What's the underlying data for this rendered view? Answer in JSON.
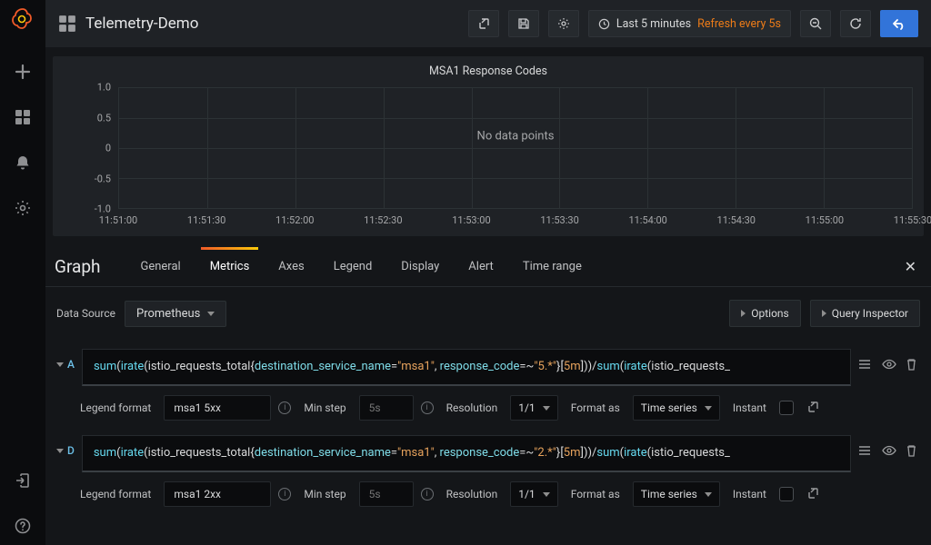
{
  "dashboard_title": "Telemetry-Demo",
  "time_range_label": "Last 5 minutes",
  "refresh_label": "Refresh every 5s",
  "chart_data": {
    "type": "line",
    "title": "MSA1 Response Codes",
    "y_ticks": [
      "-1.0",
      "-0.5",
      "0",
      "0.5",
      "1.0"
    ],
    "x_ticks": [
      "11:51:00",
      "11:51:30",
      "11:52:00",
      "11:52:30",
      "11:53:00",
      "11:53:30",
      "11:54:00",
      "11:54:30",
      "11:55:00",
      "11:55:30"
    ],
    "message": "No data points",
    "series": [],
    "ylim": [
      -1.0,
      1.0
    ]
  },
  "editor": {
    "title": "Graph",
    "tabs": [
      "General",
      "Metrics",
      "Axes",
      "Legend",
      "Display",
      "Alert",
      "Time range"
    ],
    "active_tab": "Metrics",
    "datasource_label": "Data Source",
    "datasource_value": "Prometheus",
    "options_btn": "Options",
    "inspector_btn": "Query Inspector"
  },
  "queries": [
    {
      "letter": "A",
      "tokens": [
        {
          "t": "fn",
          "v": "sum"
        },
        {
          "t": "p",
          "v": "("
        },
        {
          "t": "fn",
          "v": "irate"
        },
        {
          "t": "p",
          "v": "("
        },
        {
          "t": "m",
          "v": "istio_requests_total"
        },
        {
          "t": "p",
          "v": "{"
        },
        {
          "t": "l",
          "v": "destination_service_name"
        },
        {
          "t": "op",
          "v": "="
        },
        {
          "t": "s",
          "v": "\"msa1\""
        },
        {
          "t": "op",
          "v": ", "
        },
        {
          "t": "l",
          "v": "response_code"
        },
        {
          "t": "op",
          "v": "=~"
        },
        {
          "t": "s",
          "v": "\"5.*\""
        },
        {
          "t": "p",
          "v": "}"
        },
        {
          "t": "p",
          "v": "["
        },
        {
          "t": "d",
          "v": "5m"
        },
        {
          "t": "p",
          "v": "]"
        },
        {
          "t": "p",
          "v": ")"
        },
        {
          "t": "p",
          "v": ")"
        },
        {
          "t": "op",
          "v": "/"
        },
        {
          "t": "fn",
          "v": "sum"
        },
        {
          "t": "p",
          "v": "("
        },
        {
          "t": "fn",
          "v": "irate"
        },
        {
          "t": "p",
          "v": "("
        },
        {
          "t": "m",
          "v": "istio_requests_"
        }
      ],
      "legend_format": "msa1 5xx",
      "min_step_placeholder": "5s",
      "resolution": "1/1",
      "format_as": "Time series",
      "instant_label": "Instant"
    },
    {
      "letter": "D",
      "tokens": [
        {
          "t": "fn",
          "v": "sum"
        },
        {
          "t": "p",
          "v": "("
        },
        {
          "t": "fn",
          "v": "irate"
        },
        {
          "t": "p",
          "v": "("
        },
        {
          "t": "m",
          "v": "istio_requests_total"
        },
        {
          "t": "p",
          "v": "{"
        },
        {
          "t": "l",
          "v": "destination_service_name"
        },
        {
          "t": "op",
          "v": "="
        },
        {
          "t": "s",
          "v": "\"msa1\""
        },
        {
          "t": "op",
          "v": ", "
        },
        {
          "t": "l",
          "v": "response_code"
        },
        {
          "t": "op",
          "v": "=~"
        },
        {
          "t": "s",
          "v": "\"2.*\""
        },
        {
          "t": "p",
          "v": "}"
        },
        {
          "t": "p",
          "v": "["
        },
        {
          "t": "d",
          "v": "5m"
        },
        {
          "t": "p",
          "v": "]"
        },
        {
          "t": "p",
          "v": ")"
        },
        {
          "t": "p",
          "v": ")"
        },
        {
          "t": "op",
          "v": "/"
        },
        {
          "t": "fn",
          "v": "sum"
        },
        {
          "t": "p",
          "v": "("
        },
        {
          "t": "fn",
          "v": "irate"
        },
        {
          "t": "p",
          "v": "("
        },
        {
          "t": "m",
          "v": "istio_requests_"
        }
      ],
      "legend_format": "msa1 2xx",
      "min_step_placeholder": "5s",
      "resolution": "1/1",
      "format_as": "Time series",
      "instant_label": "Instant"
    }
  ],
  "labels": {
    "legend_format": "Legend format",
    "min_step": "Min step",
    "resolution": "Resolution",
    "format_as": "Format as"
  }
}
